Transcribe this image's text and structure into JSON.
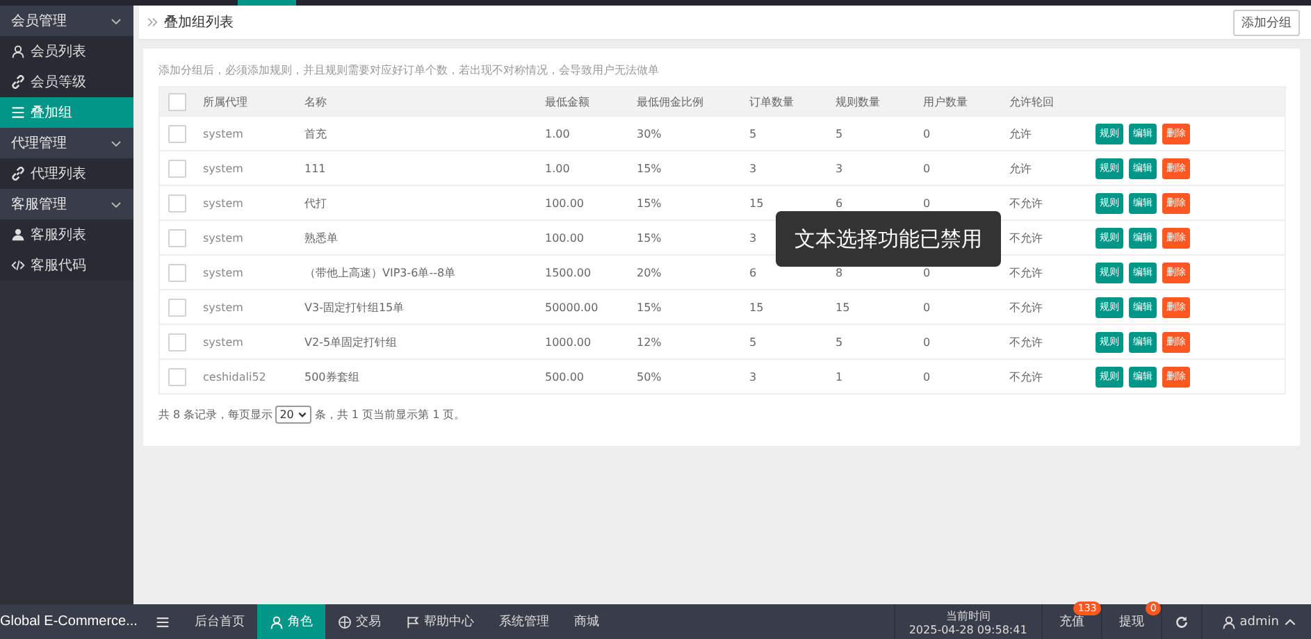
{
  "sidebar": {
    "groups": [
      {
        "label": "会员管理",
        "expanded": true,
        "items": [
          {
            "label": "会员列表",
            "selected": false
          },
          {
            "label": "会员等级",
            "selected": false
          },
          {
            "label": "叠加组",
            "selected": true
          }
        ]
      },
      {
        "label": "代理管理",
        "expanded": true,
        "items": [
          {
            "label": "代理列表",
            "selected": false
          }
        ]
      },
      {
        "label": "客服管理",
        "expanded": true,
        "items": [
          {
            "label": "客服列表",
            "selected": false
          },
          {
            "label": "客服代码",
            "selected": false
          }
        ]
      }
    ]
  },
  "breadcrumb": {
    "title": "叠加组列表",
    "button": "添加分组"
  },
  "note": "添加分组后，必须添加规则，并且规则需要对应好订单个数，若出现不对称情况，会导致用户无法做单",
  "table": {
    "columns": [
      "所属代理",
      "名称",
      "最低金额",
      "最低佣金比例",
      "订单数量",
      "规则数量",
      "用户数量",
      "允许轮回"
    ],
    "header_checked": false,
    "rows": [
      {
        "checked": false,
        "agent": "system",
        "name": "首充",
        "min_amount": "1.00",
        "min_ratio": "30%",
        "orders": "5",
        "rules": "5",
        "users": "0",
        "allow_loop": "允许",
        "actions": [
          {
            "label": "规则",
            "kind": "normal"
          },
          {
            "label": "编辑",
            "kind": "normal"
          },
          {
            "label": "删除",
            "kind": "danger"
          }
        ]
      },
      {
        "checked": false,
        "agent": "system",
        "name": "111",
        "min_amount": "1.00",
        "min_ratio": "15%",
        "orders": "3",
        "rules": "3",
        "users": "0",
        "allow_loop": "允许",
        "actions": [
          {
            "label": "规则",
            "kind": "normal"
          },
          {
            "label": "编辑",
            "kind": "normal"
          },
          {
            "label": "删除",
            "kind": "danger"
          }
        ]
      },
      {
        "checked": false,
        "agent": "system",
        "name": "代打",
        "min_amount": "100.00",
        "min_ratio": "15%",
        "orders": "15",
        "rules": "6",
        "users": "0",
        "allow_loop": "不允许",
        "actions": [
          {
            "label": "规则",
            "kind": "normal"
          },
          {
            "label": "编辑",
            "kind": "normal"
          },
          {
            "label": "删除",
            "kind": "danger"
          }
        ]
      },
      {
        "checked": false,
        "agent": "system",
        "name": "熟悉单",
        "min_amount": "100.00",
        "min_ratio": "15%",
        "orders": "3",
        "allow_loop": "不允许",
        "actions": [
          {
            "label": "规则",
            "kind": "normal"
          },
          {
            "label": "编辑",
            "kind": "normal"
          },
          {
            "label": "删除",
            "kind": "danger"
          }
        ]
      },
      {
        "checked": false,
        "agent": "system",
        "name": "（带他上高速）VIP3-6单--8单",
        "min_amount": "1500.00",
        "min_ratio": "20%",
        "orders": "6",
        "rules": "8",
        "users": "0",
        "allow_loop": "不允许",
        "actions": [
          {
            "label": "规则",
            "kind": "normal"
          },
          {
            "label": "编辑",
            "kind": "normal"
          },
          {
            "label": "删除",
            "kind": "danger"
          }
        ]
      },
      {
        "checked": false,
        "agent": "system",
        "name": "V3-固定打针组15单",
        "min_amount": "50000.00",
        "min_ratio": "15%",
        "orders": "15",
        "rules": "15",
        "users": "0",
        "allow_loop": "不允许",
        "actions": [
          {
            "label": "规则",
            "kind": "normal"
          },
          {
            "label": "编辑",
            "kind": "normal"
          },
          {
            "label": "删除",
            "kind": "danger"
          }
        ]
      },
      {
        "checked": false,
        "agent": "system",
        "name": "V2-5单固定打针组",
        "min_amount": "1000.00",
        "min_ratio": "12%",
        "orders": "5",
        "rules": "5",
        "users": "0",
        "allow_loop": "不允许",
        "actions": [
          {
            "label": "规则",
            "kind": "normal"
          },
          {
            "label": "编辑",
            "kind": "normal"
          },
          {
            "label": "删除",
            "kind": "danger"
          }
        ]
      },
      {
        "checked": false,
        "agent": "ceshidali52",
        "name": "500券套组",
        "min_amount": "500.00",
        "min_ratio": "50%",
        "orders": "3",
        "rules": "1",
        "users": "0",
        "allow_loop": "不允许",
        "actions": [
          {
            "label": "规则",
            "kind": "normal"
          },
          {
            "label": "编辑",
            "kind": "normal"
          },
          {
            "label": "删除",
            "kind": "danger"
          }
        ]
      }
    ]
  },
  "pagination": {
    "before": "共 8 条记录，每页显示",
    "page_size": "20",
    "after": "条，共 1 页当前显示第 1 页。"
  },
  "toast": "文本选择功能已禁用",
  "taskbar": {
    "brand": "Global E-Commerce...",
    "tabs": [
      {
        "label": "后台首页",
        "selected": false
      },
      {
        "label": "角色",
        "selected": true
      },
      {
        "label": "交易",
        "selected": false
      },
      {
        "label": "帮助中心",
        "selected": false
      },
      {
        "label": "系统管理",
        "selected": false
      },
      {
        "label": "商城",
        "selected": false
      }
    ],
    "clock": {
      "label": "当前时间",
      "time": "2025-04-28 09:58:41"
    },
    "buttons": [
      {
        "label": "充值",
        "badge": "133"
      },
      {
        "label": "提现",
        "badge": "0"
      }
    ],
    "user": "admin"
  }
}
